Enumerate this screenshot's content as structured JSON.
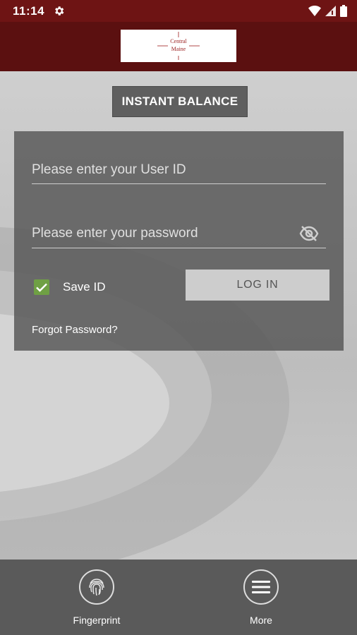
{
  "status_bar": {
    "time": "11:14"
  },
  "header": {
    "logo_text_line1": "Central",
    "logo_text_line2": "Maine"
  },
  "instant_balance": {
    "label": "INSTANT BALANCE"
  },
  "login_form": {
    "user_id_placeholder": "Please enter your User ID",
    "password_placeholder": "Please enter your password",
    "save_id_label": "Save ID",
    "save_id_checked": true,
    "login_button_label": "LOG IN",
    "forgot_password_label": "Forgot Password?"
  },
  "bottom_nav": {
    "items": [
      {
        "label": "Fingerprint",
        "icon": "fingerprint-icon"
      },
      {
        "label": "More",
        "icon": "menu-icon"
      }
    ]
  },
  "colors": {
    "header": "#5b1010",
    "status_bar": "#6e1414",
    "checkbox": "#6fa044"
  }
}
